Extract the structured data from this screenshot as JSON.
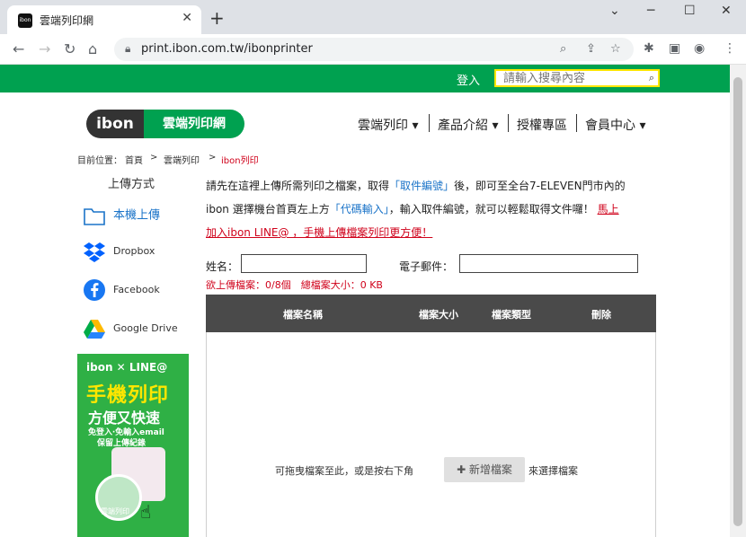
{
  "browser": {
    "tab_title": "雲端列印網",
    "tab_favicon_text": "ibon",
    "url": "print.ibon.com.tw/ibonprinter"
  },
  "header": {
    "login": "登入",
    "search_placeholder": "請輸入搜尋內容"
  },
  "logo": {
    "brand": "ibon",
    "name": "雲端列印網"
  },
  "topnav": [
    {
      "label": "雲端列印"
    },
    {
      "label": "產品介紹"
    },
    {
      "label": "授權專區"
    },
    {
      "label": "會員中心"
    }
  ],
  "breadcrumb": {
    "prefix": "目前位置：",
    "home": "首頁",
    "sep": ">",
    "cloud": "雲端列印",
    "current": "ibon列印"
  },
  "sidebar": {
    "heading": "上傳方式",
    "items": [
      {
        "label": "本機上傳",
        "icon": "folder-icon"
      },
      {
        "label": "Dropbox",
        "icon": "dropbox-icon"
      },
      {
        "label": "Facebook",
        "icon": "facebook-icon"
      },
      {
        "label": "Google Drive",
        "icon": "google-drive-icon"
      }
    ]
  },
  "promo": {
    "brand": "ibon ✕ LINE@",
    "headline": "手機列印",
    "subline": "方便又快速",
    "line1": "免登入‧免輸入email",
    "line2": "保留上傳紀錄",
    "circle_text": "雲端列印"
  },
  "intro": {
    "p1a": "請先在這裡上傳所需列印之檔案，取得",
    "p1b": "「取件編號」",
    "p1c": "後，即可至全台7-ELEVEN門市內的",
    "p2a": "ibon 選擇機台首頁左上方",
    "p2b": "「代碼輸入」",
    "p2c": "，輸入取件編號，就可以輕鬆取得文件囉！",
    "p2d": "馬上",
    "p3": "加入ibon LINE@ ，手機上傳檔案列印更方便！"
  },
  "form": {
    "name_label": "姓名：",
    "email_label": "電子郵件：",
    "name_value": "",
    "email_value": ""
  },
  "counter": "欲上傳檔案：0/8個　總檔案大小：0 KB",
  "table": {
    "headers": [
      "檔案名稱",
      "檔案大小",
      "檔案類型",
      "刪除"
    ]
  },
  "dropzone": {
    "text": "可拖曳檔案至此，或是按右下角",
    "button": "✚ 新增檔案",
    "tail": "來選擇檔案"
  },
  "colors": {
    "brand_green": "#00a150",
    "accent_red": "#d0021b",
    "link_blue": "#1a73c8",
    "header_dark": "#4a4a4a"
  }
}
